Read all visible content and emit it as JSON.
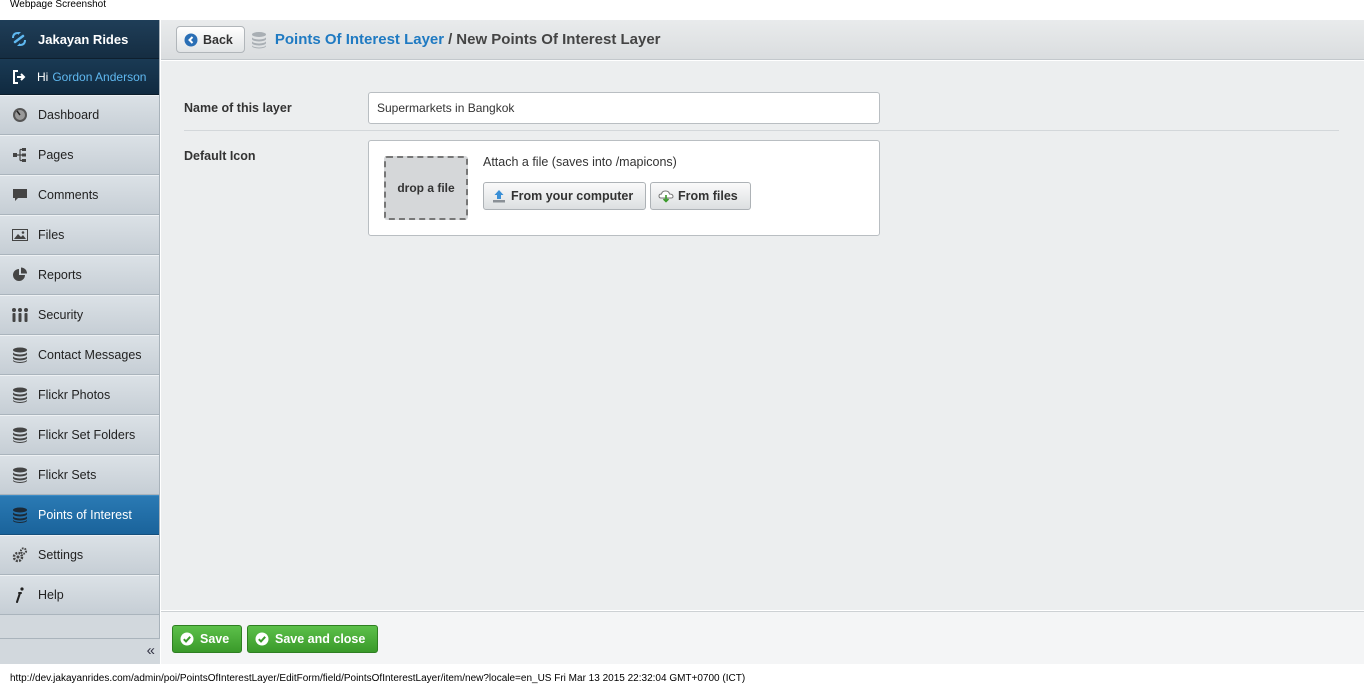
{
  "caption": "Webpage Screenshot",
  "brand": {
    "name": "Jakayan Rides",
    "icon": "logo-icon"
  },
  "greeting": {
    "prefix": "Hi",
    "user": "Gordon Anderson"
  },
  "sidebar": {
    "items": [
      {
        "label": "Dashboard",
        "icon": "dashboard-icon"
      },
      {
        "label": "Pages",
        "icon": "sitemap-icon"
      },
      {
        "label": "Comments",
        "icon": "comment-icon"
      },
      {
        "label": "Files",
        "icon": "image-icon"
      },
      {
        "label": "Reports",
        "icon": "pie-chart-icon"
      },
      {
        "label": "Security",
        "icon": "users-icon"
      },
      {
        "label": "Contact Messages",
        "icon": "database-icon"
      },
      {
        "label": "Flickr Photos",
        "icon": "database-icon"
      },
      {
        "label": "Flickr Set Folders",
        "icon": "database-icon"
      },
      {
        "label": "Flickr Sets",
        "icon": "database-icon"
      },
      {
        "label": "Points of Interest",
        "icon": "database-icon",
        "active": true
      },
      {
        "label": "Settings",
        "icon": "gears-icon"
      },
      {
        "label": "Help",
        "icon": "info-icon"
      }
    ],
    "collapse_label": "«"
  },
  "header": {
    "back_label": "Back",
    "breadcrumb_parent": "Points Of Interest Layer",
    "breadcrumb_separator": "/",
    "breadcrumb_current": "New Points Of Interest Layer"
  },
  "form": {
    "name_label": "Name of this layer",
    "name_value": "Supermarkets in Bangkok",
    "icon_label": "Default Icon",
    "dropzone_label": "drop a file",
    "attach_text": "Attach a file (saves into /mapicons)",
    "from_computer_label": "From your computer",
    "from_files_label": "From files"
  },
  "actions": {
    "save_label": "Save",
    "save_close_label": "Save and close"
  },
  "footer_url": "http://dev.jakayanrides.com/admin/poi/PointsOfInterestLayer/EditForm/field/PointsOfInterestLayer/item/new?locale=en_US Fri Mar 13 2015 22:32:04 GMT+0700 (ICT)",
  "colors": {
    "accent": "#1f7ac2",
    "active_nav": "#1a639b",
    "save_green": "#3a9a2a",
    "sidebar_dark": "#152d42"
  }
}
